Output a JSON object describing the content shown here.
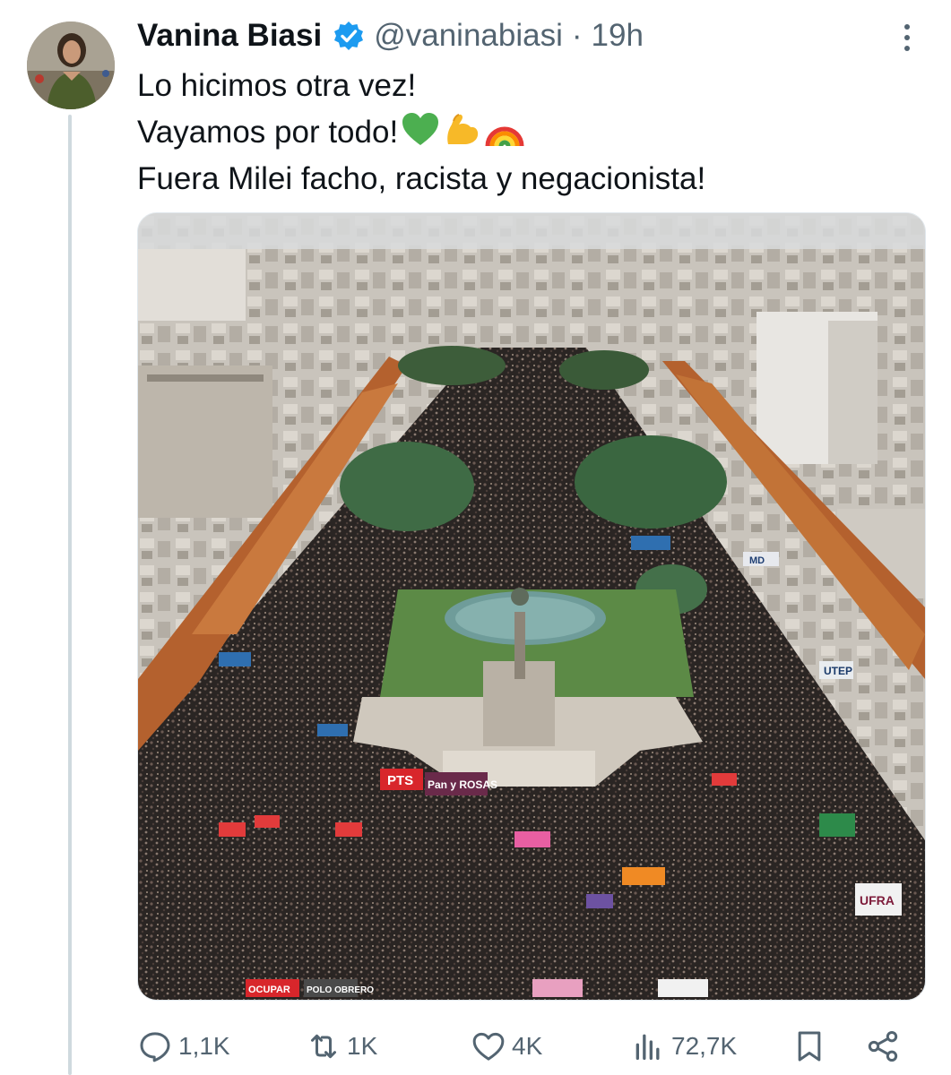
{
  "tweet": {
    "author_name": "Vanina Biasi",
    "handle": "@vaninabiasi",
    "separator": "·",
    "time": "19h",
    "lines": [
      "Lo hicimos otra vez!",
      "Vayamos por todo!",
      "Fuera Milei facho, racista y negacionista!"
    ],
    "emojis": [
      "green-heart",
      "flexed-biceps",
      "rainbow"
    ]
  },
  "photo": {
    "banners": [
      "PTS",
      "Pan y ROSAS",
      "UTEP",
      "MD",
      "UFRA",
      "OCUPAR",
      "POLO OBRERO"
    ]
  },
  "actions": {
    "replies": "1,1K",
    "reposts": "1K",
    "likes": "4K",
    "views": "72,7K"
  },
  "colors": {
    "text": "#0f1419",
    "secondary": "#536471",
    "verified": "#1d9bf0",
    "thread_line": "#cfd9de"
  }
}
